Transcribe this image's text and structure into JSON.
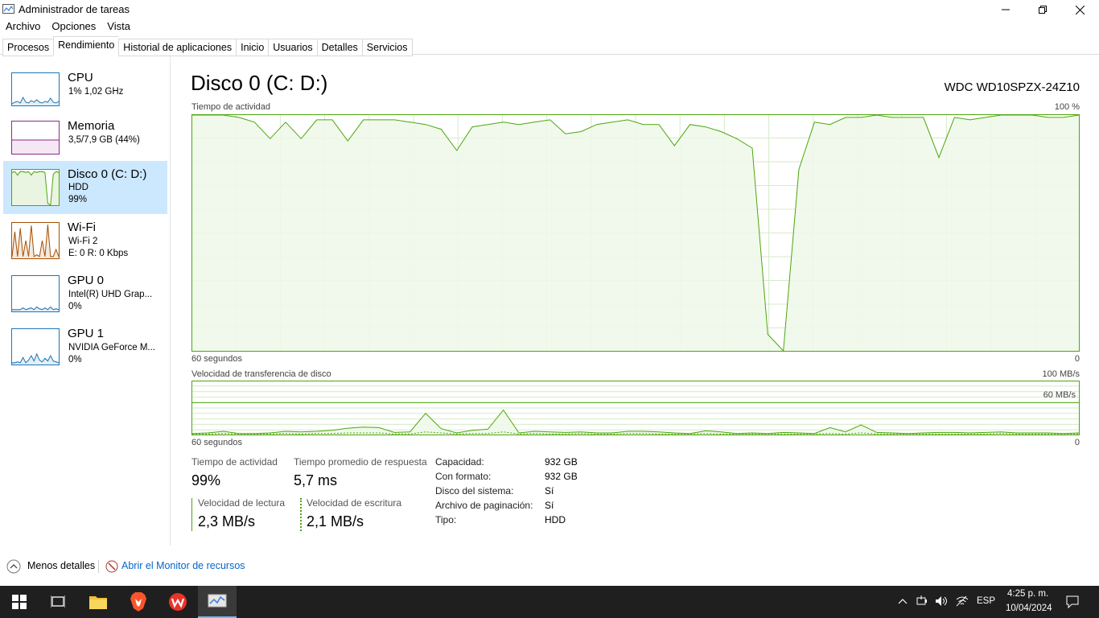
{
  "window": {
    "title": "Administrador de tareas"
  },
  "menu": [
    "Archivo",
    "Opciones",
    "Vista"
  ],
  "tabs": [
    "Procesos",
    "Rendimiento",
    "Historial de aplicaciones",
    "Inicio",
    "Usuarios",
    "Detalles",
    "Servicios"
  ],
  "active_tab": "Rendimiento",
  "sidebar": [
    {
      "name": "CPU",
      "line2": "1% 1,02 GHz",
      "line3": "",
      "color": "#1f77b4"
    },
    {
      "name": "Memoria",
      "line2": "3,5/7,9 GB (44%)",
      "line3": "",
      "color": "#8b2a8b"
    },
    {
      "name": "Disco 0 (C: D:)",
      "line2": "HDD",
      "line3": "99%",
      "color": "#4da60c"
    },
    {
      "name": "Wi-Fi",
      "line2": "Wi-Fi 2",
      "line3": "E: 0 R: 0 Kbps",
      "color": "#a74f01"
    },
    {
      "name": "GPU 0",
      "line2": "Intel(R) UHD Grap...",
      "line3": "0%",
      "color": "#1f77b4"
    },
    {
      "name": "GPU 1",
      "line2": "NVIDIA GeForce M...",
      "line3": "0%",
      "color": "#1f77b4"
    }
  ],
  "main": {
    "title": "Disco 0 (C: D:)",
    "model": "WDC WD10SPZX-24Z10",
    "graph1_label": "Tiempo de actividad",
    "graph1_max": "100 %",
    "graph1_left": "60 segundos",
    "graph1_right": "0",
    "graph2_label": "Velocidad de transferencia de disco",
    "graph2_max": "100 MB/s",
    "graph2_mark": "60 MB/s",
    "graph2_left": "60 segundos",
    "graph2_right": "0"
  },
  "chart_data": [
    {
      "type": "area",
      "title": "Tiempo de actividad",
      "ylim": [
        0,
        100
      ],
      "values": [
        100,
        100,
        100,
        99,
        97,
        90,
        97,
        90,
        98,
        98,
        89,
        98,
        98,
        98,
        97,
        96,
        94,
        85,
        95,
        96,
        97,
        96,
        97,
        98,
        92,
        93,
        96,
        97,
        98,
        96,
        96,
        87,
        96,
        95,
        93,
        90,
        86,
        7,
        0,
        77,
        97,
        96,
        99,
        99,
        100,
        99,
        99,
        99,
        82,
        99,
        98,
        99,
        100,
        100,
        100,
        99,
        99,
        100
      ]
    },
    {
      "type": "area",
      "title": "Velocidad de transferencia de disco",
      "ylim": [
        0,
        100
      ],
      "series": [
        {
          "name": "Velocidad de lectura",
          "values": [
            2,
            3,
            6,
            2,
            2,
            3,
            6,
            5,
            6,
            8,
            12,
            14,
            13,
            4,
            5,
            40,
            11,
            3,
            8,
            10,
            46,
            3,
            6,
            5,
            4,
            5,
            3,
            3,
            6,
            6,
            5,
            3,
            2,
            7,
            5,
            2,
            3,
            2,
            4,
            3,
            2,
            13,
            5,
            18,
            4,
            3,
            2,
            3,
            4,
            4,
            3,
            4,
            5,
            3,
            3,
            3,
            2,
            3
          ]
        },
        {
          "name": "Velocidad de escritura",
          "values": [
            1,
            1,
            2,
            1,
            1,
            1,
            2,
            1,
            2,
            2,
            3,
            3,
            3,
            1,
            1,
            5,
            3,
            1,
            2,
            2,
            5,
            1,
            2,
            1,
            1,
            2,
            1,
            1,
            2,
            2,
            1,
            1,
            1,
            2,
            1,
            1,
            1,
            1,
            1,
            1,
            1,
            2,
            1,
            3,
            1,
            1,
            1,
            1,
            1,
            1,
            1,
            1,
            2,
            1,
            1,
            1,
            1,
            1
          ]
        }
      ]
    }
  ],
  "stats": {
    "actividad_label": "Tiempo de actividad",
    "actividad_value": "99%",
    "respuesta_label": "Tiempo promedio de respuesta",
    "respuesta_value": "5,7 ms",
    "lectura_label": "Velocidad de lectura",
    "lectura_value": "2,3 MB/s",
    "escritura_label": "Velocidad de escritura",
    "escritura_value": "2,1 MB/s"
  },
  "properties": [
    {
      "key": "Capacidad:",
      "value": "932 GB"
    },
    {
      "key": "Con formato:",
      "value": "932 GB"
    },
    {
      "key": "Disco del sistema:",
      "value": "Sí"
    },
    {
      "key": "Archivo de paginación:",
      "value": "Sí"
    },
    {
      "key": "Tipo:",
      "value": "HDD"
    }
  ],
  "footer": {
    "less_details": "Menos detalles",
    "monitor_link": "Abrir el Monitor de recursos"
  },
  "taskbar": {
    "lang": "ESP",
    "time": "4:25 p. m.",
    "date": "10/04/2024"
  },
  "colors": {
    "disk": "#4da60c",
    "disk_fill": "#eff8e9",
    "grid": "#d6ebc6",
    "selection": "#cce8ff",
    "taskbar": "#1f1f1f"
  }
}
